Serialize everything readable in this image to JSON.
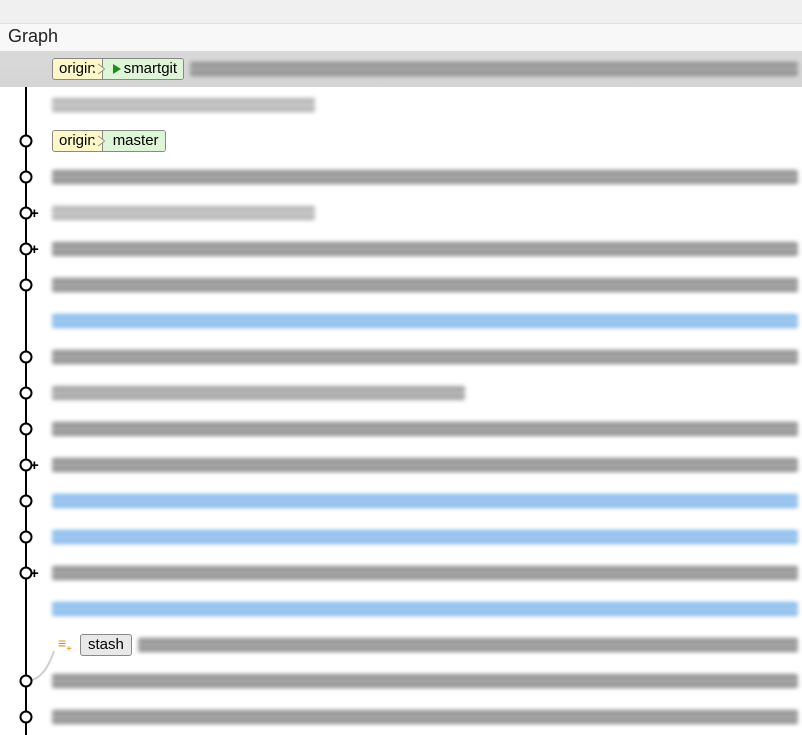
{
  "header": {
    "title": "Graph"
  },
  "labels": {
    "origin": "origin",
    "smartgit": "smartgit",
    "master": "master",
    "stash": "stash"
  },
  "rows": [
    {
      "node": true,
      "plus": false,
      "refs": "origin_smartgit",
      "selected": true,
      "bar": "blur-gray-long"
    },
    {
      "node": false,
      "plus": false,
      "bar": "blur-gray-short"
    },
    {
      "node": true,
      "plus": false,
      "refs": "origin_master",
      "bar": ""
    },
    {
      "node": true,
      "plus": false,
      "bar": "blur-gray-long"
    },
    {
      "node": true,
      "plus": true,
      "bar": "blur-gray-short"
    },
    {
      "node": true,
      "plus": true,
      "bar": "blur-gray-long"
    },
    {
      "node": true,
      "plus": false,
      "bar": "blur-gray-long"
    },
    {
      "node": false,
      "plus": false,
      "bar": "blur-blue"
    },
    {
      "node": true,
      "plus": false,
      "bar": "blur-gray-long"
    },
    {
      "node": true,
      "plus": false,
      "bar": "blur-gray-med"
    },
    {
      "node": true,
      "plus": false,
      "bar": "blur-gray-long"
    },
    {
      "node": true,
      "plus": true,
      "bar": "blur-gray-long"
    },
    {
      "node": true,
      "plus": false,
      "bar": "blur-blue"
    },
    {
      "node": true,
      "plus": false,
      "bar": "blur-blue"
    },
    {
      "node": true,
      "plus": true,
      "bar": "blur-gray-long"
    },
    {
      "node": false,
      "plus": false,
      "bar": "blur-blue"
    },
    {
      "node": false,
      "plus": false,
      "refs": "stash",
      "bar": "blur-gray-long",
      "stash": true
    },
    {
      "node": true,
      "plus": false,
      "bar": "blur-gray-long"
    },
    {
      "node": true,
      "plus": false,
      "bar": "blur-gray-long"
    }
  ]
}
